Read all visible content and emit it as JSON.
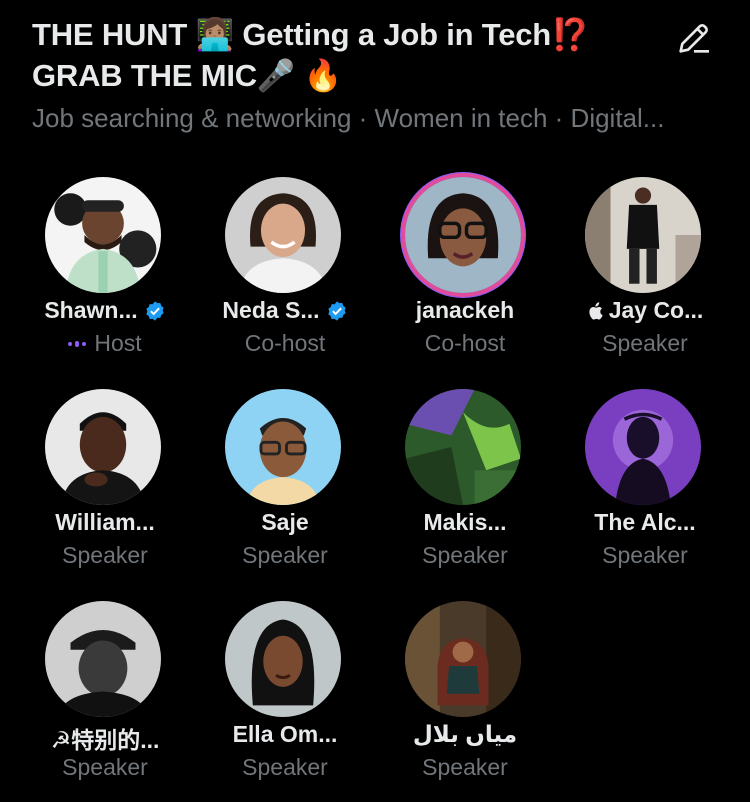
{
  "space": {
    "title_line1": "THE HUNT 👩🏽‍💻 Getting a Job in Tech⁉️",
    "title_line2": "GRAB THE MIC🎤 🔥",
    "topics": "Job searching & networking · Women in tech · Digital..."
  },
  "icons": {
    "edit": "pencil-edit-icon",
    "verified": "verified-badge-icon",
    "host": "audio-levels-icon",
    "apple": "apple-logo-icon"
  },
  "colors": {
    "background": "#000000",
    "text": "#e7e9ea",
    "muted": "#71767b",
    "verified": "#1d9bf0",
    "host_accent": "#8b5cf6",
    "ring": "#e14b9c"
  },
  "participants": [
    {
      "name": "Shawn...",
      "role": "Host",
      "verified": true
    },
    {
      "name": "Neda S...",
      "role": "Co-host",
      "verified": true
    },
    {
      "name": "janackeh",
      "role": "Co-host",
      "verified": false
    },
    {
      "name": "Jay Co...",
      "role": "Speaker",
      "verified": false
    },
    {
      "name": "William...",
      "role": "Speaker",
      "verified": false
    },
    {
      "name": "Saje",
      "role": "Speaker",
      "verified": false
    },
    {
      "name": "Makis...",
      "role": "Speaker",
      "verified": false
    },
    {
      "name": "The Alc...",
      "role": "Speaker",
      "verified": false
    },
    {
      "name": "☭特别的...",
      "role": "Speaker",
      "verified": false
    },
    {
      "name": "Ella Om...",
      "role": "Speaker",
      "verified": false
    },
    {
      "name": "میاں بلال",
      "role": "Speaker",
      "verified": false
    }
  ]
}
